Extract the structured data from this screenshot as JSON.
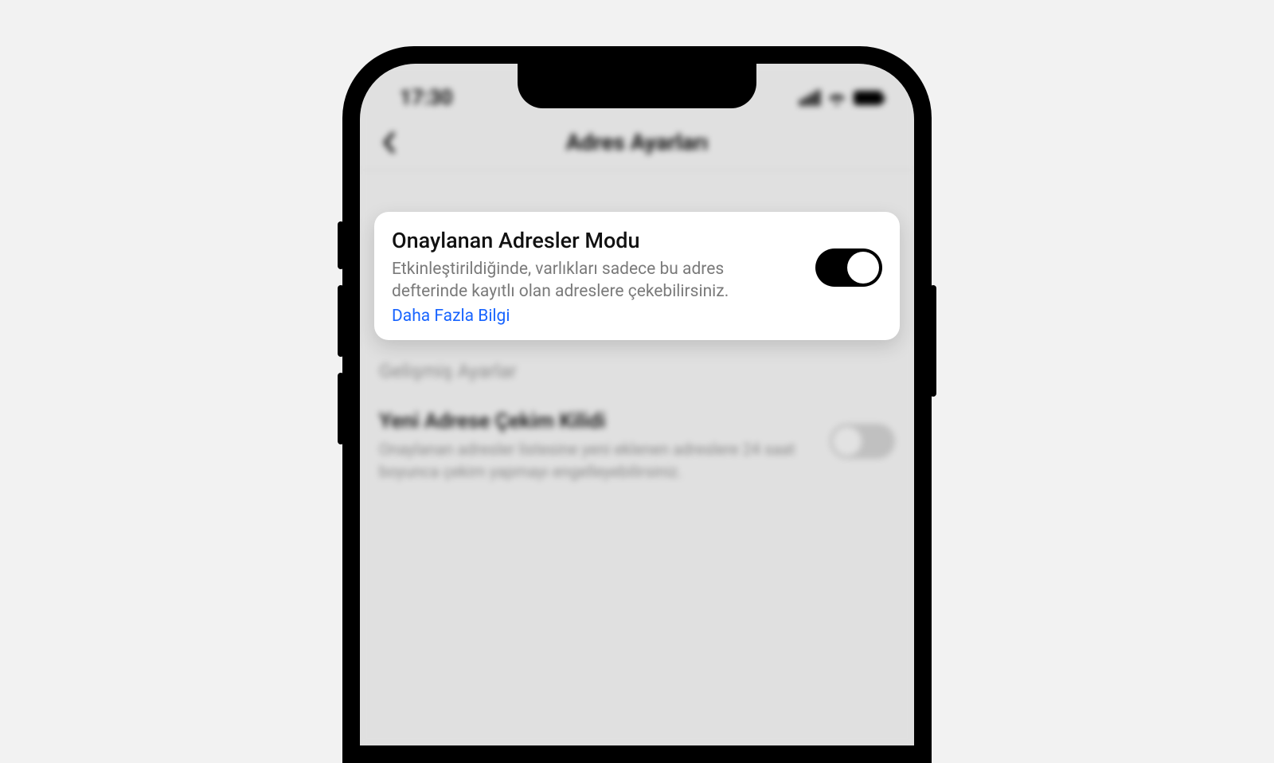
{
  "status": {
    "time": "17:30"
  },
  "header": {
    "title": "Adres Ayarları"
  },
  "card": {
    "title": "Onaylanan Adresler Modu",
    "description": "Etkinleştirildiğinde, varlıkları sadece bu adres defterinde kayıtlı olan adreslere çekebilirsiniz.",
    "learn_more": "Daha Fazla Bilgi"
  },
  "sections": {
    "advanced": "Gelişmiş Ayarlar"
  },
  "setting2": {
    "title": "Yeni Adrese Çekim Kilidi",
    "description": "Onaylanan adresler listesine yeni eklenen adreslere 24 saat boyunca çekim yapmayı engelleyebilirsiniz."
  }
}
